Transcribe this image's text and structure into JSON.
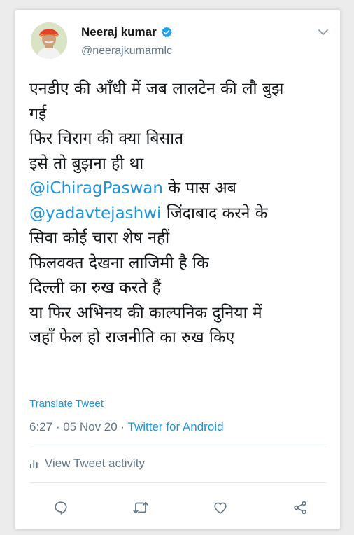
{
  "tweet": {
    "author_name": "Neeraj kumar",
    "author_handle": "@neerajkumarmlc",
    "lines": [
      {
        "text": "एनडीए की आँधी में जब लालटेन की लौ बुझ",
        "mention": "",
        "rest": ""
      },
      {
        "text": "गई",
        "mention": "",
        "rest": ""
      },
      {
        "text": "फिर चिराग की क्या बिसात",
        "mention": "",
        "rest": ""
      },
      {
        "text": "इसे तो बुझना ही था",
        "mention": "",
        "rest": ""
      },
      {
        "text": "",
        "mention": "@iChiragPaswan",
        "rest": " के पास अब"
      },
      {
        "text": "",
        "mention": "@yadavtejashwi",
        "rest": " जिंदाबाद करने के"
      },
      {
        "text": "सिवा कोई चारा शेष नहीं",
        "mention": "",
        "rest": ""
      },
      {
        "text": "फिलवक्त देखना लाजिमी है कि",
        "mention": "",
        "rest": ""
      },
      {
        "text": "दिल्ली का रुख करते हैं",
        "mention": "",
        "rest": ""
      },
      {
        "text": "या फिर अभिनय की काल्पनिक दुनिया में",
        "mention": "",
        "rest": ""
      },
      {
        "text": "जहाँ फेल हो राजनीति का रुख किए",
        "mention": "",
        "rest": ""
      }
    ],
    "translate_label": "Translate Tweet",
    "time": "6:27",
    "separator": " · ",
    "date": "05 Nov 20",
    "source": "Twitter for Android",
    "activity_label": "View Tweet activity"
  },
  "icons": {
    "verified": "verified-badge-icon",
    "caret": "chevron-down-icon",
    "activity": "bar-chart-icon",
    "reply": "reply-icon",
    "retweet": "retweet-icon",
    "like": "heart-icon",
    "share": "share-icon"
  },
  "colors": {
    "link": "#1b95e0",
    "text": "#14171a",
    "secondary": "#657786",
    "verified": "#1da1f2"
  }
}
